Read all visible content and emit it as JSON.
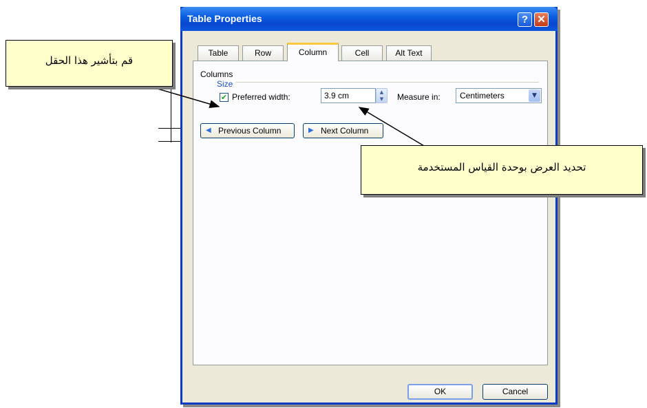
{
  "dialog": {
    "title": "Table Properties",
    "help_icon": "?",
    "close_icon": "✕"
  },
  "tabs": [
    {
      "label": "Table",
      "active": false
    },
    {
      "label": "Row",
      "active": false
    },
    {
      "label": "Column",
      "active": true
    },
    {
      "label": "Cell",
      "active": false
    },
    {
      "label": "Alt Text",
      "active": false
    }
  ],
  "column_tab": {
    "section_label": "Columns",
    "size_label": "Size",
    "preferred_width": {
      "label": "Preferred width:",
      "checked": true,
      "value": "3.9 cm"
    },
    "measure_in": {
      "label": "Measure in:",
      "value": "Centimeters"
    },
    "previous_button": "Previous Column",
    "next_button": "Next Column"
  },
  "footer": {
    "ok_label": "OK",
    "cancel_label": "Cancel"
  },
  "callouts": {
    "left": "قم بتأشير هذا الحقل",
    "right": "تحديد العرض بوحدة القياس المستخدمة"
  },
  "colors": {
    "titlebar": "#0b5ee0",
    "callout_fill": "#ffffcc",
    "active_tab_highlight": "#ffc83c"
  }
}
